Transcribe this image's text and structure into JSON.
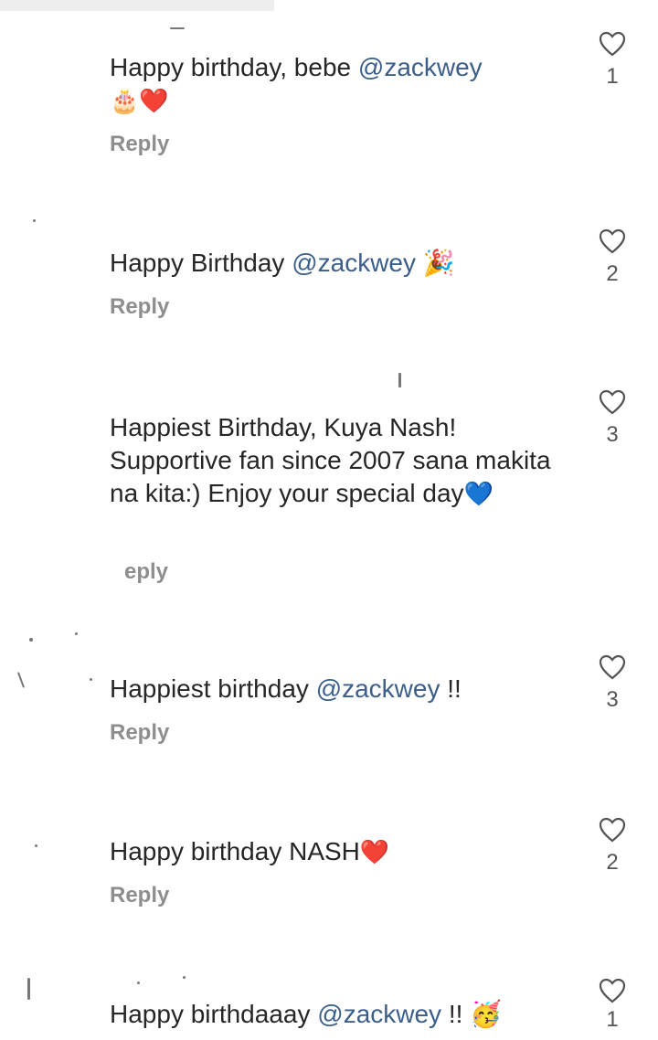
{
  "comments": [
    {
      "text": "Happy birthday, bebe ",
      "mention": "@zackwey",
      "emoji_line": "🎂❤️",
      "reply_label": "Reply",
      "likes": "1"
    },
    {
      "text": "Happy Birthday ",
      "mention": "@zackwey",
      "after": " 🎉",
      "reply_label": "Reply",
      "likes": "2"
    },
    {
      "text": "Happiest Birthday, Kuya Nash! Supportive fan since 2007 sana makita na kita:) Enjoy your special day",
      "emoji": "💙",
      "reply_label": "eply",
      "likes": "3"
    },
    {
      "text": "Happiest birthday ",
      "mention": "@zackwey",
      "after": " !!",
      "reply_label": "Reply",
      "likes": "3"
    },
    {
      "text": "Happy birthday NASH",
      "emoji": "❤️",
      "reply_label": "Reply",
      "likes": "2"
    },
    {
      "text": "Happy birthdaaay ",
      "mention": "@zackwey",
      "after": " !! 🥳",
      "likes": "1"
    }
  ],
  "icons": {
    "like": "heart-outline-icon"
  },
  "colors": {
    "mention": "#3b5f8a",
    "reply": "#8e8e8e",
    "text": "#262626"
  }
}
